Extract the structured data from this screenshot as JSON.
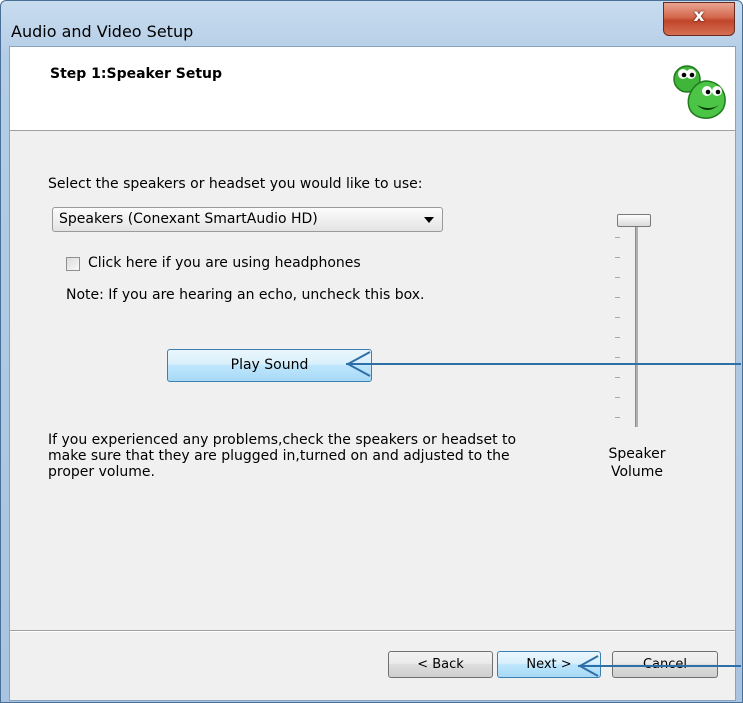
{
  "window": {
    "title": "Audio and Video Setup",
    "close_glyph": "x"
  },
  "header": {
    "step_title": "Step 1:Speaker Setup",
    "mascot_icon": "green-mascot-icon"
  },
  "speaker": {
    "select_label": "Select the speakers or headset you would like to use:",
    "selected_device": "Speakers (Conexant SmartAudio HD)",
    "headphones_checkbox_label": "Click here if you are using headphones",
    "headphones_checked": false,
    "note": "Note: If you are hearing an echo, uncheck this box.",
    "play_sound_label": "Play Sound",
    "help_text": "If you experienced any problems,check the speakers or headset to\nmake sure that they are plugged in,turned on and adjusted to the\nproper volume."
  },
  "volume": {
    "label": "Speaker\nVolume",
    "level": 1.0
  },
  "footer": {
    "back_label": "< Back",
    "next_label": "Next >",
    "cancel_label": "Cancel"
  },
  "colors": {
    "annotation_arrow": "#2f6fa7",
    "accent_blue": "#3c7fb1"
  }
}
